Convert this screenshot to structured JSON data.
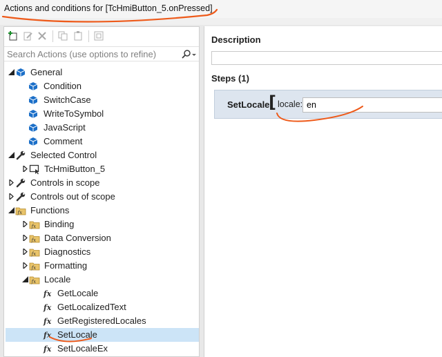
{
  "window": {
    "title": "Actions and conditions for [TcHmiButton_5.onPressed]"
  },
  "search": {
    "placeholder": "Search Actions (use options to refine)"
  },
  "tree": {
    "general": "General",
    "condition": "Condition",
    "switchcase": "SwitchCase",
    "writetosymbol": "WriteToSymbol",
    "javascript": "JavaScript",
    "comment": "Comment",
    "selected_control": "Selected Control",
    "tchmibutton5": "TcHmiButton_5",
    "controls_in_scope": "Controls in scope",
    "controls_out_of_scope": "Controls out of scope",
    "functions": "Functions",
    "binding": "Binding",
    "data_conversion": "Data Conversion",
    "diagnostics": "Diagnostics",
    "formatting": "Formatting",
    "locale": "Locale",
    "getlocale": "GetLocale",
    "getlocalizedtext": "GetLocalizedText",
    "getregisteredlocales": "GetRegisteredLocales",
    "setlocale": "SetLocale",
    "setlocaleex": "SetLocaleEx"
  },
  "description": {
    "title": "Description",
    "value": ""
  },
  "steps": {
    "title": "Steps (1)",
    "items": [
      {
        "name": "SetLocale",
        "bracket": "[",
        "param_label": "locale:",
        "param_value": "en"
      }
    ]
  },
  "icons": {
    "add": "add-icon",
    "edit": "edit-icon",
    "delete": "delete-icon",
    "copy": "copy-icon",
    "paste": "paste-icon",
    "group": "group-icon",
    "search": "search-icon",
    "function": "fx-icon",
    "folder": "fx-folder-icon",
    "cube": "cube-icon",
    "wrench": "wrench-icon",
    "control": "control-icon"
  },
  "colors": {
    "selection": "#cce4f7",
    "annotation": "#ee5a1a",
    "step_card": "#dde5ef",
    "cube": "#1b6fc8"
  }
}
